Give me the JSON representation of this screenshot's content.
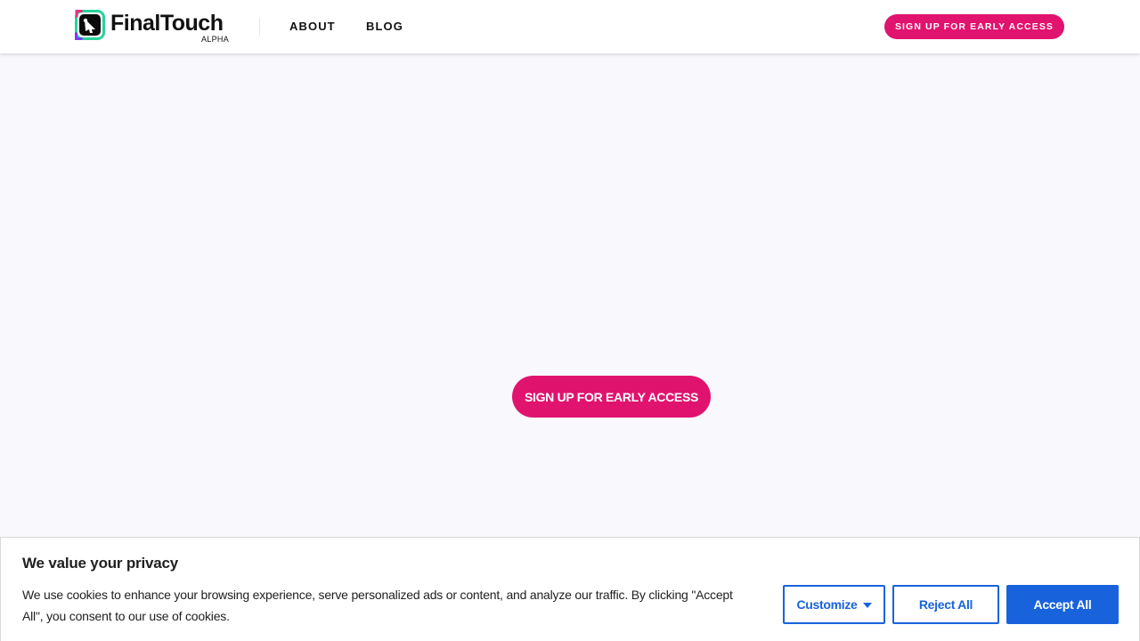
{
  "brand": {
    "name": "FinalTouch",
    "tag": "ALPHA"
  },
  "nav": {
    "about": "ABOUT",
    "blog": "BLOG",
    "cta": "SIGN UP FOR EARLY ACCESS"
  },
  "hero": {
    "cta": "SIGN UP FOR EARLY ACCESS"
  },
  "cookie": {
    "title": "We value your privacy",
    "text": "We use cookies to enhance your browsing experience, serve personalized ads or content, and analyze our traffic. By clicking \"Accept All\", you consent to our use of cookies.",
    "customize": "Customize",
    "reject": "Reject All",
    "accept": "Accept All"
  },
  "colors": {
    "brand_pink": "#e0136f",
    "consent_blue": "#1863dc",
    "page_bg": "#f9f8fd"
  },
  "icons": {
    "logo": "finaltouch-logo-icon",
    "customize_caret": "caret-down-icon"
  }
}
